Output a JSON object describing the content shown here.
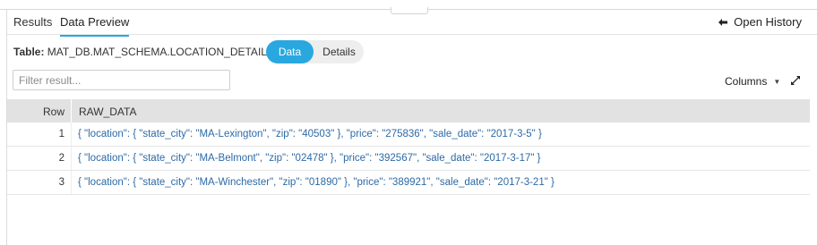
{
  "tabs": {
    "results": "Results",
    "data_preview": "Data Preview"
  },
  "open_history": "Open History",
  "table": {
    "label": "Table:",
    "name": "MAT_DB.MAT_SCHEMA.LOCATION_DETAILS"
  },
  "segment": {
    "data": "Data",
    "details": "Details",
    "active": "Data"
  },
  "filter": {
    "placeholder": "Filter result...",
    "value": ""
  },
  "columns_label": "Columns",
  "grid": {
    "headers": [
      "Row",
      "RAW_DATA"
    ],
    "rows": [
      {
        "row": "1",
        "raw": "{ \"location\": { \"state_city\": \"MA-Lexington\", \"zip\": \"40503\" }, \"price\": \"275836\", \"sale_date\": \"2017-3-5\" }"
      },
      {
        "row": "2",
        "raw": "{ \"location\": { \"state_city\": \"MA-Belmont\", \"zip\": \"02478\" }, \"price\": \"392567\", \"sale_date\": \"2017-3-17\" }"
      },
      {
        "row": "3",
        "raw": "{ \"location\": { \"state_city\": \"MA-Winchester\", \"zip\": \"01890\" }, \"price\": \"389921\", \"sale_date\": \"2017-3-21\" }"
      }
    ]
  },
  "colors": {
    "accent": "#29a8e0",
    "json_text": "#2d6aa6",
    "header_bg": "#e2e2e2"
  },
  "icons": [
    "back-arrow-icon",
    "caret-down-icon",
    "expand-icon"
  ]
}
